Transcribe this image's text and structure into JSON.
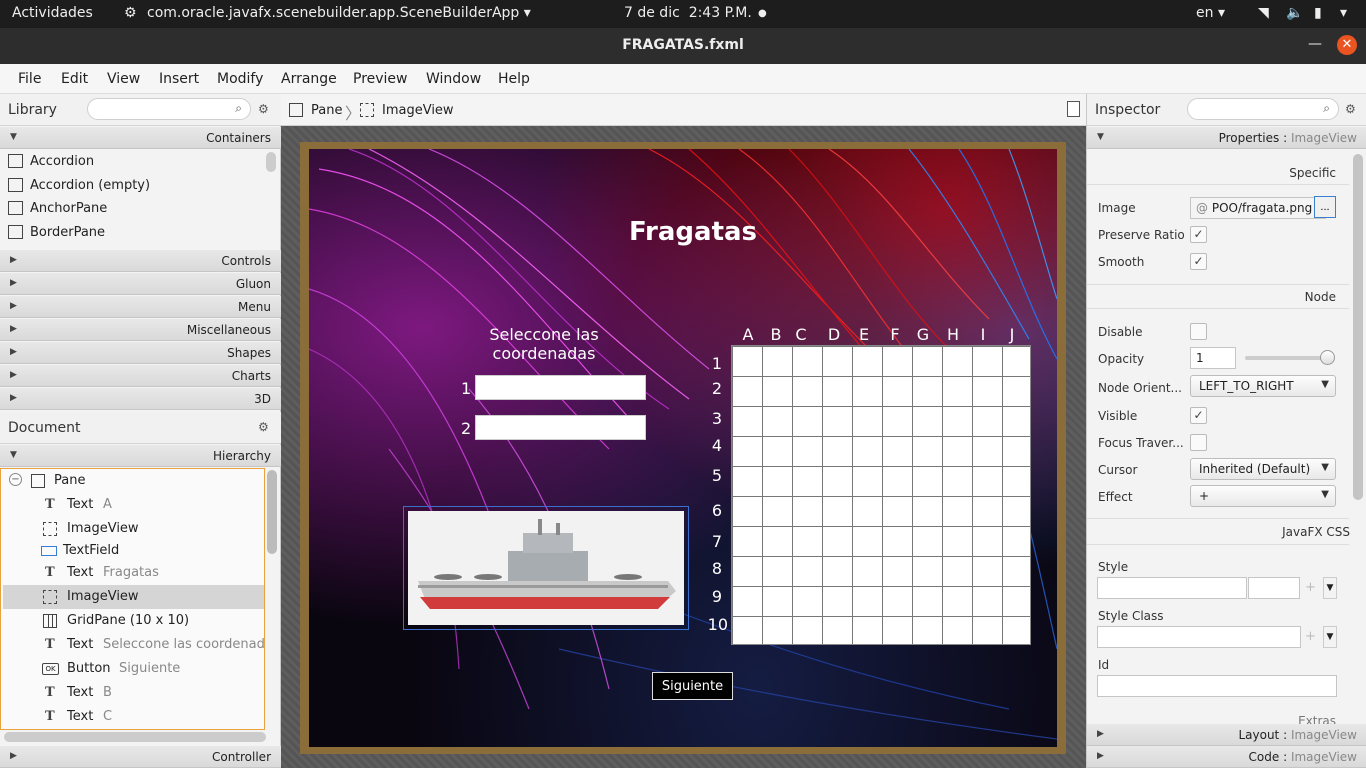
{
  "os": {
    "activities": "Actividades",
    "app_name": "com.oracle.javafx.scenebuilder.app.SceneBuilderApp",
    "date": "7 de dic",
    "time": "2:43 P.M.",
    "lang": "en"
  },
  "window": {
    "title": "FRAGATAS.fxml"
  },
  "menubar": [
    "File",
    "Edit",
    "View",
    "Insert",
    "Modify",
    "Arrange",
    "Preview",
    "Window",
    "Help"
  ],
  "library": {
    "title": "Library",
    "containers_label": "Containers",
    "items": [
      "Accordion",
      "Accordion  (empty)",
      "AnchorPane",
      "BorderPane"
    ],
    "sections": [
      "Controls",
      "Gluon",
      "Menu",
      "Miscellaneous",
      "Shapes",
      "Charts",
      "3D"
    ]
  },
  "document": {
    "title": "Document",
    "hierarchy_label": "Hierarchy",
    "controller_label": "Controller",
    "items": [
      {
        "type": "Pane",
        "value": ""
      },
      {
        "type": "Text",
        "value": "A"
      },
      {
        "type": "ImageView",
        "value": ""
      },
      {
        "type": "TextField",
        "value": ""
      },
      {
        "type": "Text",
        "value": "Fragatas"
      },
      {
        "type": "ImageView",
        "value": ""
      },
      {
        "type": "GridPane (10 x 10)",
        "value": ""
      },
      {
        "type": "Text",
        "value": "Seleccone las coordenad"
      },
      {
        "type": "Button",
        "value": "Siguiente"
      },
      {
        "type": "Text",
        "value": "B"
      },
      {
        "type": "Text",
        "value": "C"
      }
    ]
  },
  "breadcrumb": [
    "Pane",
    "ImageView"
  ],
  "scene": {
    "title": "Fragatas",
    "prompt": "Seleccone las coordenadas",
    "field1_label": "1",
    "field2_label": "2",
    "button": "Siguiente",
    "columns": [
      "A",
      "B",
      "C",
      "D",
      "E",
      "F",
      "G",
      "H",
      "I",
      "J"
    ],
    "rows": [
      "1",
      "2",
      "3",
      "4",
      "5",
      "6",
      "7",
      "8",
      "9",
      "10"
    ]
  },
  "inspector": {
    "title": "Inspector",
    "properties_label": "Properties",
    "properties_target": "ImageView",
    "specific_label": "Specific",
    "image_label": "Image",
    "image_value": "POO/fragata.png",
    "image_prefix": "@",
    "browse": "...",
    "preserve_ratio": "Preserve Ratio",
    "smooth": "Smooth",
    "node_label": "Node",
    "disable": "Disable",
    "opacity": "Opacity",
    "opacity_value": "1",
    "node_orient": "Node Orient...",
    "node_orient_value": "LEFT_TO_RIGHT",
    "visible": "Visible",
    "focus": "Focus Traver...",
    "cursor": "Cursor",
    "cursor_value": "Inherited (Default)",
    "effect": "Effect",
    "effect_value": "+",
    "css_label": "JavaFX CSS",
    "style": "Style",
    "style_class": "Style Class",
    "id": "Id",
    "extras": "Extras",
    "layout_label": "Layout",
    "layout_target": "ImageView",
    "code_label": "Code",
    "code_target": "ImageView"
  }
}
